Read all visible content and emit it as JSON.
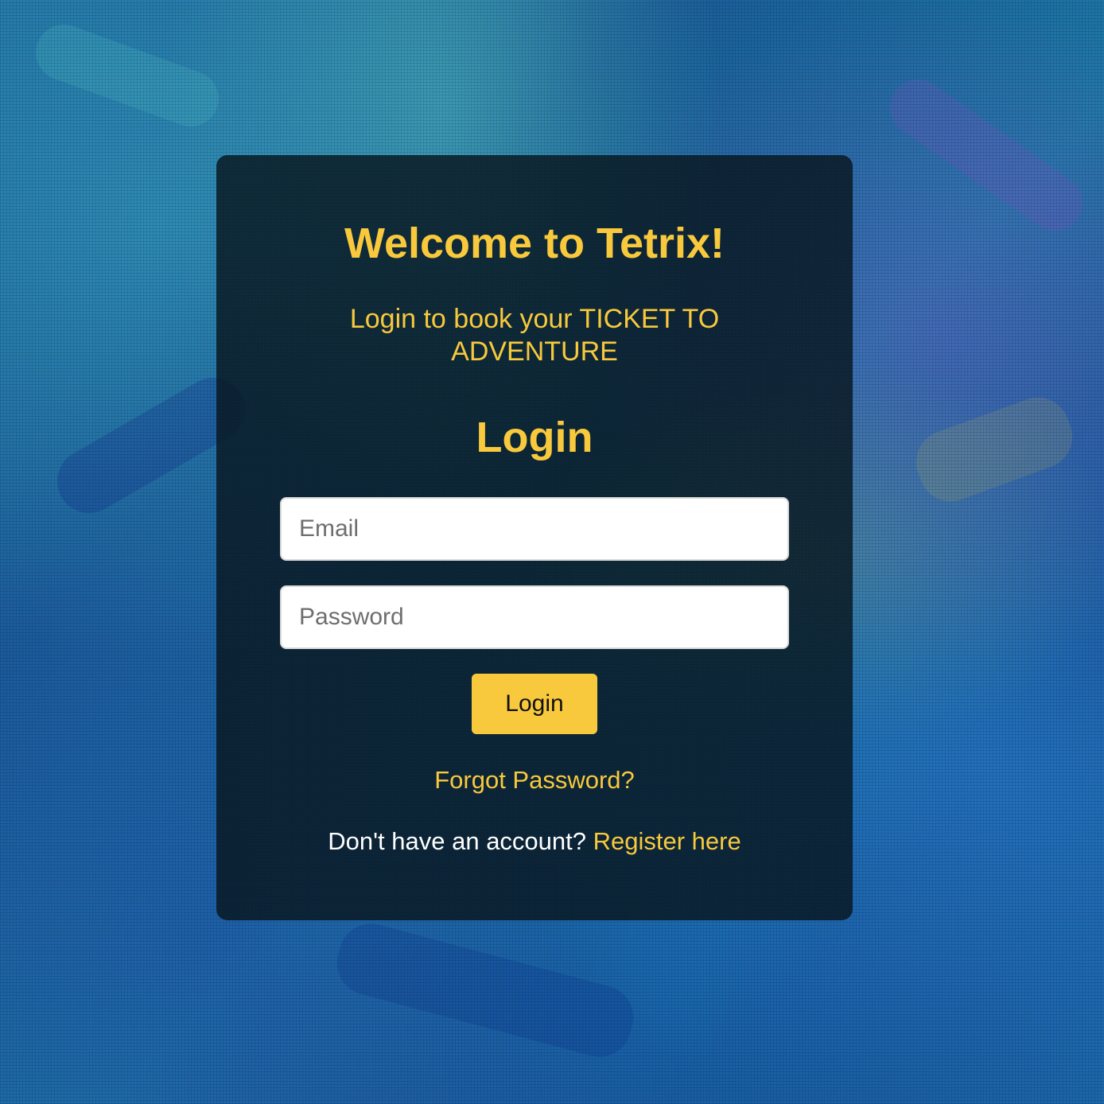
{
  "colors": {
    "accent": "#f8c93c",
    "card_background": "rgba(8,22,30,0.82)",
    "button_text": "#111111"
  },
  "header": {
    "title": "Welcome to Tetrix!",
    "subtitle": "Login to book your TICKET TO ADVENTURE"
  },
  "form": {
    "heading": "Login",
    "email": {
      "value": "",
      "placeholder": "Email"
    },
    "password": {
      "value": "",
      "placeholder": "Password"
    },
    "submit_label": "Login",
    "forgot_password_label": "Forgot Password?",
    "register_prompt": "Don't have an account?",
    "register_link_label": "Register here"
  }
}
